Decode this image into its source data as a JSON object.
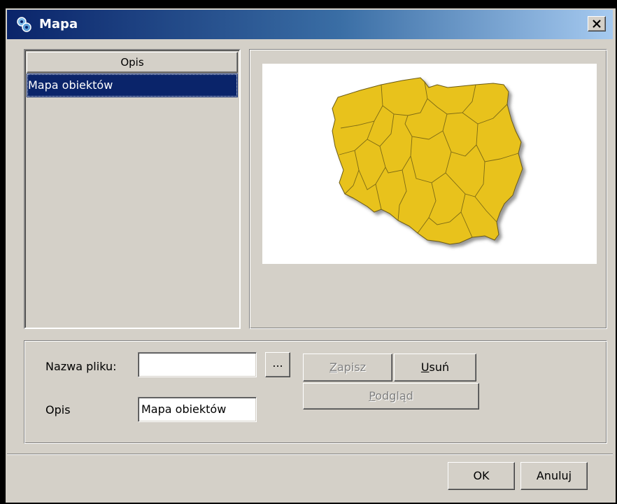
{
  "window": {
    "title": "Mapa",
    "close_label": "✕",
    "title_icon": "gears-icon"
  },
  "list": {
    "header": "Opis",
    "items": [
      {
        "label": "Mapa obiektów",
        "selected": true
      }
    ]
  },
  "preview": {
    "image": "poland-voivodeships-map",
    "map_color": "#e8c21e",
    "border_color": "#5a4a10"
  },
  "form": {
    "filename_label": "Nazwa pliku:",
    "filename_value": "",
    "browse_label": "...",
    "description_label": "Opis",
    "description_value": "Mapa obiektów",
    "save_label_pre": "",
    "save_label_key": "Z",
    "save_label_post": "apisz",
    "delete_label_pre": "",
    "delete_label_key": "U",
    "delete_label_post": "suń",
    "preview_label_pre": "",
    "preview_label_key": "P",
    "preview_label_post": "odgląd"
  },
  "footer": {
    "ok_label": "OK",
    "cancel_label": "Anuluj"
  },
  "colors": {
    "titlebar_start": "#0a246a",
    "titlebar_end": "#a6caf0",
    "selection": "#0a246a",
    "face": "#d4d0c8"
  }
}
